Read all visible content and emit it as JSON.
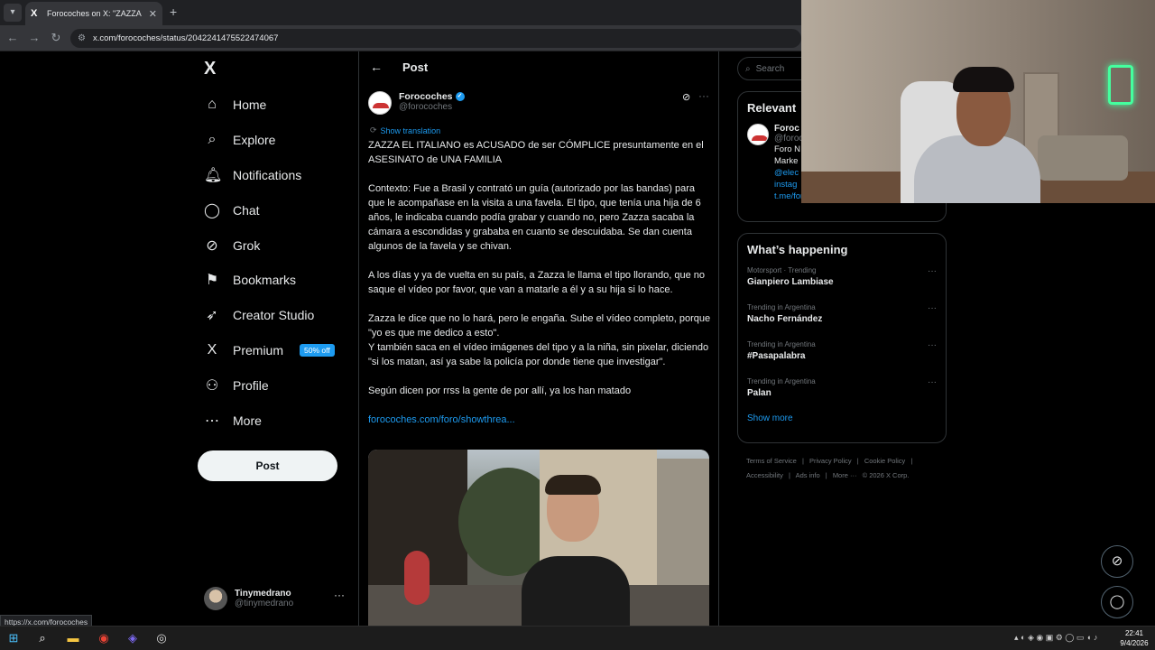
{
  "browser": {
    "tab_title": "Forocoches on X: \"ZAZZA EL ITA",
    "tab_close": "✕",
    "new_tab": "+",
    "url": "x.com/forocoches/status/2042241475522474067",
    "status_url": "https://x.com/forocoches"
  },
  "nav": {
    "logo": "X",
    "items": [
      {
        "label": "Home",
        "icon": "⌂"
      },
      {
        "label": "Explore",
        "icon": "⌕"
      },
      {
        "label": "Notifications",
        "icon": "🔔︎"
      },
      {
        "label": "Chat",
        "icon": "◯"
      },
      {
        "label": "Grok",
        "icon": "⊘"
      },
      {
        "label": "Bookmarks",
        "icon": "⚑"
      },
      {
        "label": "Creator Studio",
        "icon": "➶"
      },
      {
        "label": "Premium",
        "icon": "X",
        "badge": "50% off"
      },
      {
        "label": "Profile",
        "icon": "⚇"
      },
      {
        "label": "More",
        "icon": "⋯"
      }
    ],
    "post_button": "Post",
    "account": {
      "name": "Tinymedrano",
      "handle": "@tinymedrano",
      "more": "···"
    }
  },
  "main": {
    "back_icon": "←",
    "title": "Post",
    "author": {
      "name": "Forocoches",
      "handle": "@forocoches",
      "verified_mark": "✓"
    },
    "more_dots": "···",
    "show_translation": "Show translation",
    "paragraphs": [
      "ZAZZA EL ITALIANO es ACUSADO de ser CÓMPLICE presuntamente en el ASESINATO de UNA FAMILIA",
      "Contexto: Fue a Brasil y contrató un guía (autorizado por las bandas) para que le acompañase en la visita a una favela. El tipo, que tenía una hija de 6 años, le indicaba cuando podía grabar y cuando no, pero Zazza sacaba la cámara a escondidas y grababa en cuanto se descuidaba. Se dan cuenta algunos de la favela y se chivan.",
      "A los días y ya de vuelta en su país, a Zazza le llama el tipo llorando, que no saque el vídeo por favor, que van a matarle a él y a su hija si lo hace.",
      "Zazza le dice que no lo hará, pero le engaña. Sube el vídeo completo, porque \"yo es que me dedico a esto\".",
      "Y también saca en el vídeo imágenes del tipo y a la niña, sin pixelar, diciendo \"si los matan, así ya sabe la policía por donde tiene que investigar\".",
      "Según dicen por rrss la gente de por allí, ya los han matado"
    ],
    "link": "forocoches.com/foro/showthrea..."
  },
  "right": {
    "search_placeholder": "Search",
    "relevant": {
      "title": "Relevant",
      "name": "Foroc",
      "handle": "@foroc",
      "bio_lines": [
        "Foro N",
        "Marke"
      ],
      "links": [
        "@elec",
        "instag",
        "t.me/forocoches_ofi..."
      ]
    },
    "happening": {
      "title": "What’s happening",
      "trends": [
        {
          "category": "Motorsport · Trending",
          "topic": "Gianpiero Lambiase"
        },
        {
          "category": "Trending in Argentina",
          "topic": "Nacho Fernández"
        },
        {
          "category": "Trending in Argentina",
          "topic": "#Pasapalabra"
        },
        {
          "category": "Trending in Argentina",
          "topic": "Palan"
        }
      ],
      "show_more": "Show more"
    },
    "footer": [
      "Terms of Service",
      "|",
      "Privacy Policy",
      "|",
      "Cookie Policy",
      "|",
      "Accessibility",
      "|",
      "Ads info",
      "|",
      "More ···",
      "© 2026 X Corp."
    ]
  },
  "taskbar": {
    "time": "22:41",
    "date": "9/4/2026"
  },
  "colors": {
    "accent": "#1d9bf0",
    "background": "#000000",
    "text": "#e7e9ea",
    "muted": "#71767b",
    "border": "#2f3336"
  }
}
